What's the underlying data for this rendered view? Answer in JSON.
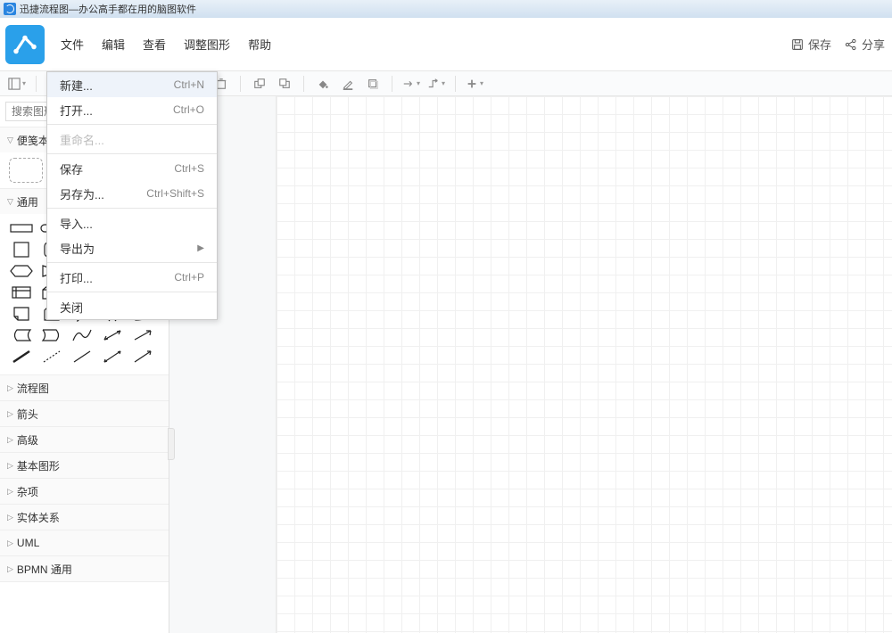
{
  "window": {
    "title": "迅捷流程图—办公高手都在用的脑图软件"
  },
  "menubar": {
    "items": [
      "文件",
      "编辑",
      "查看",
      "调整图形",
      "帮助"
    ]
  },
  "header_right": {
    "save": "保存",
    "share": "分享"
  },
  "file_menu": {
    "items": [
      {
        "label": "新建...",
        "shortcut": "Ctrl+N",
        "hover": true
      },
      {
        "label": "打开...",
        "shortcut": "Ctrl+O"
      },
      {
        "sep": true
      },
      {
        "label": "重命名...",
        "disabled": true
      },
      {
        "sep": true
      },
      {
        "label": "保存",
        "shortcut": "Ctrl+S"
      },
      {
        "label": "另存为...",
        "shortcut": "Ctrl+Shift+S"
      },
      {
        "sep": true
      },
      {
        "label": "导入..."
      },
      {
        "label": "导出为",
        "submenu": true
      },
      {
        "sep": true
      },
      {
        "label": "打印...",
        "shortcut": "Ctrl+P"
      },
      {
        "sep": true
      },
      {
        "label": "关闭"
      }
    ]
  },
  "sidebar": {
    "search_placeholder": "搜索图形",
    "sections": {
      "sticky": "便笺本",
      "general": "通用",
      "categories": [
        "流程图",
        "箭头",
        "高级",
        "基本图形",
        "杂项",
        "实体关系",
        "UML",
        "BPMN 通用"
      ]
    }
  }
}
